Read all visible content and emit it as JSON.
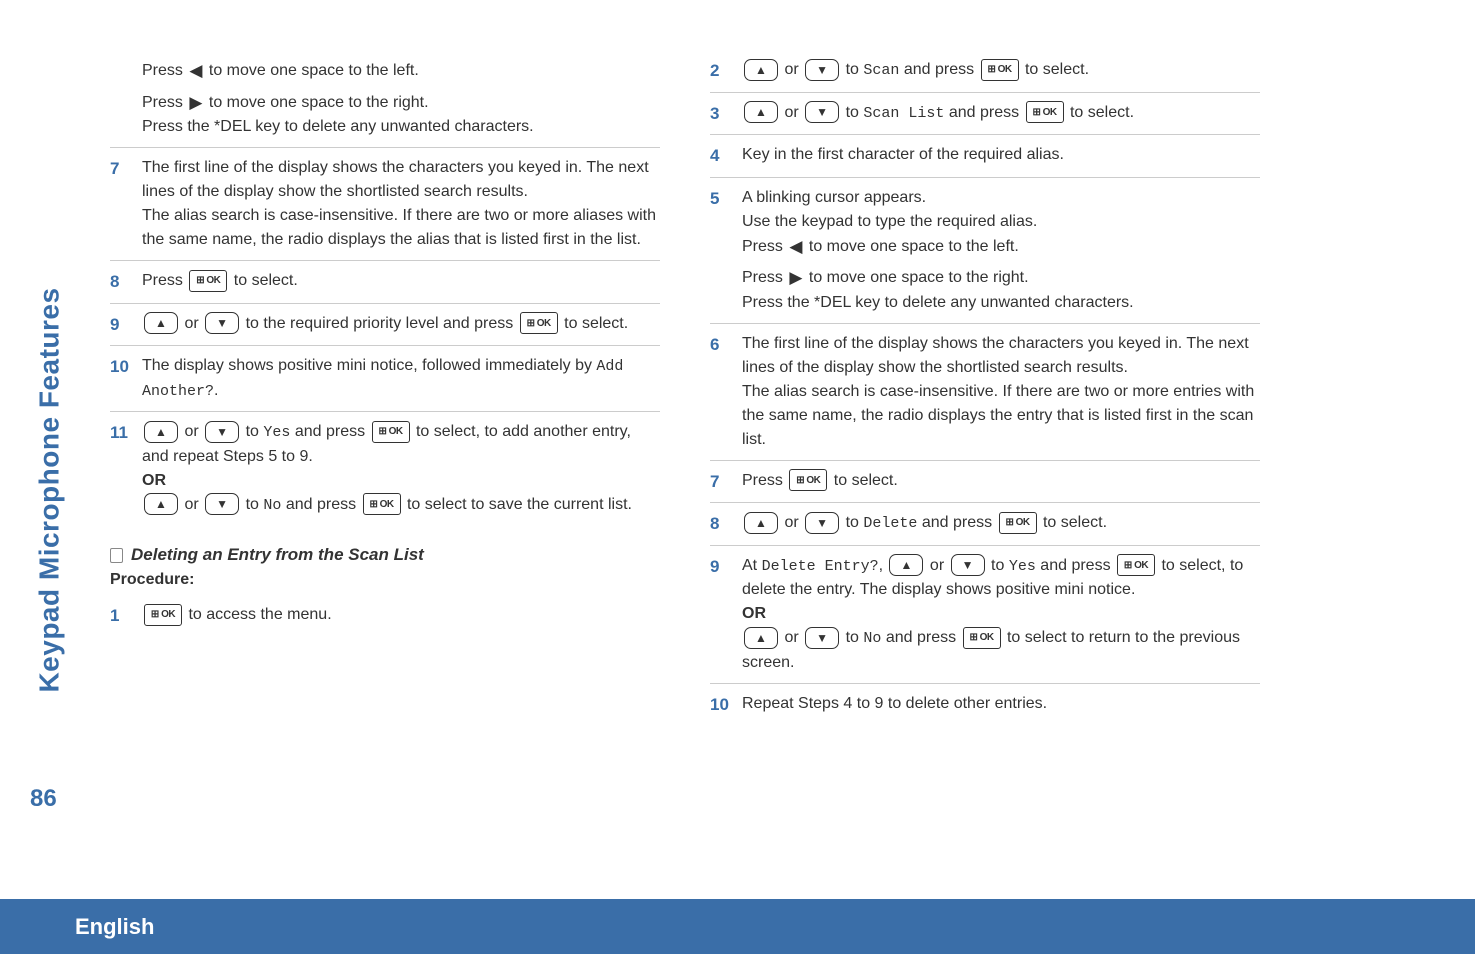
{
  "sidebar_label": "Keypad Microphone Features",
  "page_number": "86",
  "language": "English",
  "left": {
    "pre": {
      "l1a": "Press ",
      "l1b": " to move one space to the left.",
      "l2a": "Press ",
      "l2b": " to move one space to the right.",
      "l3": "Press the *DEL key to delete any unwanted characters."
    },
    "s7": {
      "num": "7",
      "p1": "The first line of the display shows the characters you keyed in. The next lines of the display show the shortlisted search results.",
      "p2": "The alias search is case-insensitive. If there are two or more aliases with the same name, the radio displays the alias that is listed first in the list."
    },
    "s8": {
      "num": "8",
      "a": "Press ",
      "b": " to select."
    },
    "s9": {
      "num": "9",
      "mid": " to the required priority level and press ",
      "end": " to select."
    },
    "s10": {
      "num": "10",
      "a": "The display shows positive mini notice, followed immediately by ",
      "mono": "Add Another?",
      "b": "."
    },
    "s11": {
      "num": "11",
      "yes_mono": "Yes",
      "a_mid": " and press ",
      "a_end": " to select, to add another entry, and repeat Steps 5 to 9.",
      "or": "OR",
      "no_mono": "No",
      "b_mid": " and press ",
      "b_end": " to select to save the current list."
    },
    "section_title": "Deleting an Entry from the Scan List",
    "procedure": "Procedure:",
    "s1": {
      "num": "1",
      "a": " to access the menu."
    }
  },
  "right": {
    "s2": {
      "num": "2",
      "mono": "Scan",
      "mid": " and press ",
      "end": " to select."
    },
    "s3": {
      "num": "3",
      "mono": "Scan List",
      "mid": " and press ",
      "end": " to select."
    },
    "s4": {
      "num": "4",
      "text": "Key in the first character of the required alias."
    },
    "s5": {
      "num": "5",
      "p1": "A blinking cursor appears.",
      "p2": "Use the keypad to type the required alias.",
      "p3a": "Press ",
      "p3b": " to move one space to the left.",
      "p4a": "Press ",
      "p4b": " to move one space to the right.",
      "p5": "Press the *DEL key to delete any unwanted characters."
    },
    "s6": {
      "num": "6",
      "p1": "The first line of the display shows the characters you keyed in. The next lines of the display show the shortlisted search results.",
      "p2": "The alias search is case-insensitive. If there are two or more entries with the same name, the radio displays the entry that is listed first in the scan list."
    },
    "s7": {
      "num": "7",
      "a": "Press ",
      "b": " to select."
    },
    "s8": {
      "num": "8",
      "mono": "Delete",
      "mid": " and press ",
      "end": " to select."
    },
    "s9": {
      "num": "9",
      "a": "At ",
      "mono1": "Delete Entry?",
      "comma": ", ",
      "mono_yes": "Yes",
      "mid1": " and press ",
      "end1": " to select, to delete the entry. The display shows positive mini notice.",
      "or": "OR",
      "mono_no": "No",
      "mid2": " and press ",
      "end2": " to select to return to the previous screen."
    },
    "s10": {
      "num": "10",
      "text": "Repeat Steps 4 to 9 to delete other entries."
    }
  },
  "or_word": " or ",
  "to_word": " to "
}
